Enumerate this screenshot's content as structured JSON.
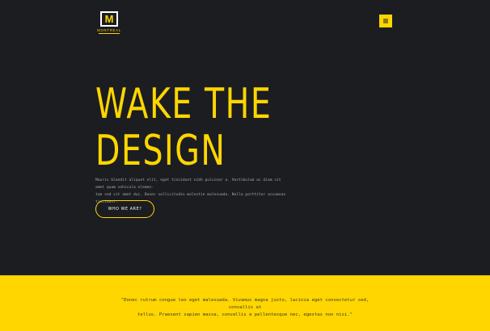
{
  "header": {
    "logo_letter": "M",
    "logo_word": "MONTREAL",
    "menu_icon": "hamburger-icon"
  },
  "hero": {
    "title_line1": "WAKE THE",
    "title_line2": "DESIGN",
    "intro_line1": "Mauris blandit aliquet elit, eget tincidunt nibh pulvinar a. Vestibulum ac diam sit amet quam vehicula elemen-",
    "intro_line2": "tum sed sit amet dui. Donec sollicitudin molestie malesuada. Nulla porttitor accumsan tincidunt.",
    "cta_label": "WHO WE ARE?"
  },
  "quote": {
    "line1": "\"Donec rutrum congue leo eget malesuada. Vivamus magna justo, lacinia eget consectetur sed, convallis at",
    "line2": "tellus. Praesent sapien massa, convallis a pellentesque nec, egestas non nisi.\""
  },
  "colors": {
    "background": "#1c1d21",
    "accent": "#ffd600",
    "text_muted": "#a8a9ad"
  }
}
